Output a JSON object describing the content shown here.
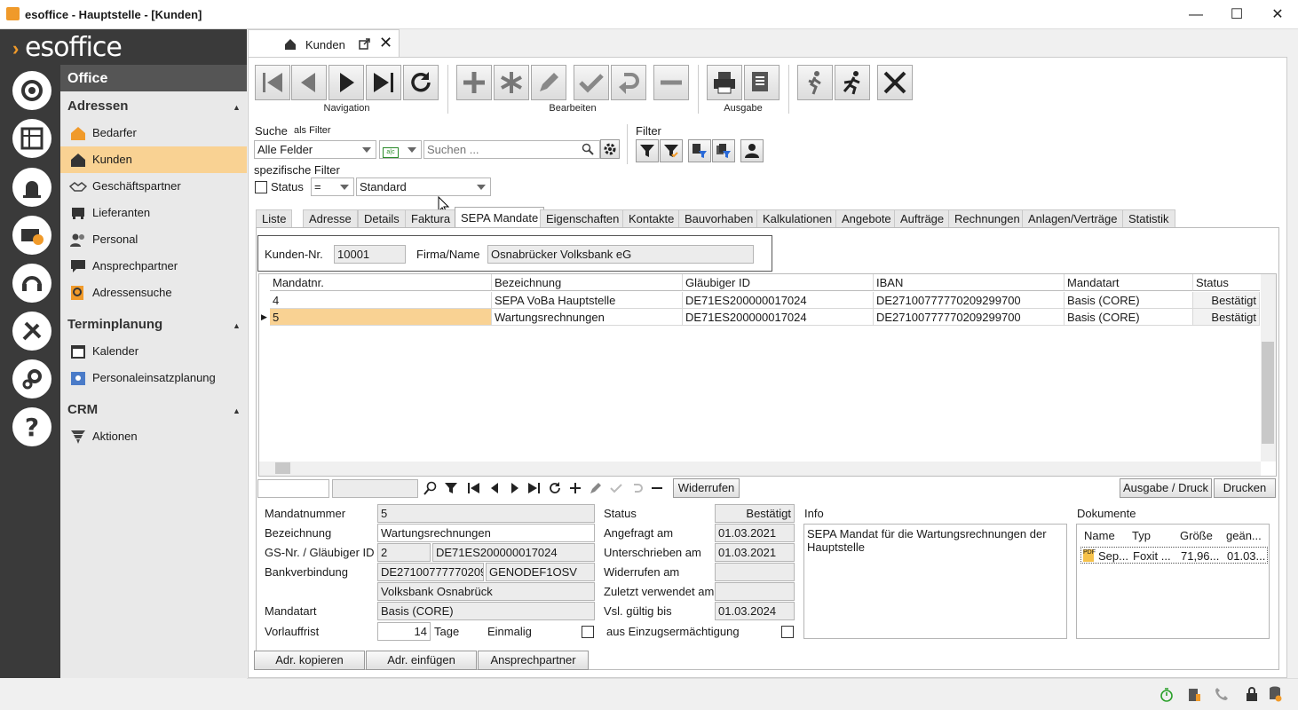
{
  "window": {
    "title": "esoffice - Hauptstelle - [Kunden]"
  },
  "logo": "esoffice",
  "nav": {
    "header": "Office",
    "sections": [
      {
        "label": "Adressen",
        "items": [
          "Bedarfer",
          "Kunden",
          "Geschäftspartner",
          "Lieferanten",
          "Personal",
          "Ansprechpartner",
          "Adressensuche"
        ]
      },
      {
        "label": "Terminplanung",
        "items": [
          "Kalender",
          "Personaleinsatzplanung"
        ]
      },
      {
        "label": "CRM",
        "items": [
          "Aktionen"
        ]
      }
    ],
    "active": "Kunden"
  },
  "doctab": {
    "label": "Kunden"
  },
  "toolbar": {
    "groups": [
      "Navigation",
      "Bearbeiten",
      "Ausgabe"
    ]
  },
  "search": {
    "label": "Suche",
    "as_filter": "als Filter",
    "field_select": "Alle Felder",
    "placeholder": "Suchen ...",
    "filter_label": "Filter",
    "specific_label": "spezifische Filter",
    "status_label": "Status",
    "operator": "=",
    "standard": "Standard"
  },
  "tabs": [
    "Liste",
    "Adresse",
    "Details",
    "Faktura",
    "SEPA Mandate",
    "Eigenschaften",
    "Kontakte",
    "Bauvorhaben",
    "Kalkulationen",
    "Angebote",
    "Aufträge",
    "Rechnungen",
    "Anlagen/Verträge",
    "Statistik"
  ],
  "selected_tab": "SEPA Mandate",
  "customer": {
    "nr_label": "Kunden-Nr.",
    "nr": "10001",
    "firma_label": "Firma/Name",
    "firma": "Osnabrücker Volksbank eG"
  },
  "grid": {
    "columns": [
      "Mandatnr.",
      "Bezeichnung",
      "Gläubiger ID",
      "IBAN",
      "Mandatart",
      "Status"
    ],
    "rows": [
      [
        "4",
        "SEPA VoBa Hauptstelle",
        "DE71ES200000017024",
        "DE27100777770209299700",
        "Basis (CORE)",
        "Bestätigt"
      ],
      [
        "5",
        "Wartungsrechnungen",
        "DE71ES200000017024",
        "DE27100777770209299700",
        "Basis (CORE)",
        "Bestätigt"
      ]
    ]
  },
  "gridbar": {
    "widerrufen": "Widerrufen",
    "ausgabe": "Ausgabe / Druck",
    "drucken": "Drucken"
  },
  "detail": {
    "mandatnummer_label": "Mandatnummer",
    "mandatnummer": "5",
    "bezeichnung_label": "Bezeichnung",
    "bezeichnung": "Wartungsrechnungen",
    "gs_label": "GS-Nr. / Gläubiger ID",
    "gs_nr": "2",
    "glaeubiger": "DE71ES200000017024",
    "bank_label": "Bankverbindung",
    "iban": "DE27100777770209",
    "bic": "GENODEF1OSV",
    "bankname": "Volksbank Osnabrück",
    "mandatart_label": "Mandatart",
    "mandatart": "Basis (CORE)",
    "vorlauf_label": "Vorlauffrist",
    "vorlauf": "14",
    "tage": "Tage",
    "einmalig": "Einmalig",
    "status_label": "Status",
    "status": "Bestätigt",
    "angefragt_label": "Angefragt am",
    "angefragt": "01.03.2021",
    "unterschrieben_label": "Unterschrieben am",
    "unterschrieben": "01.03.2021",
    "widerrufen_label": "Widerrufen am",
    "widerrufen": "",
    "zuletzt_label": "Zuletzt verwendet am",
    "zuletzt": "",
    "gueltig_label": "Vsl. gültig bis",
    "gueltig": "01.03.2024",
    "einzug_label": "aus Einzugsermächtigung",
    "info_label": "Info",
    "info": "SEPA Mandat für die Wartungsrechnungen der Hauptstelle",
    "dok_label": "Dokumente",
    "dok_columns": [
      "Name",
      "Typ",
      "Größe",
      "geän..."
    ],
    "dok_row": [
      "Sep...",
      "Foxit ...",
      "71,96...",
      "01.03..."
    ]
  },
  "bottom_buttons": [
    "Adr. kopieren",
    "Adr. einfügen",
    "Ansprechpartner"
  ]
}
